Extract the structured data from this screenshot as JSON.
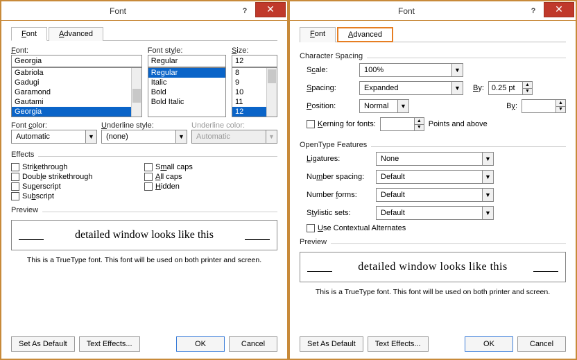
{
  "dialog1": {
    "title": "Font",
    "tabs": {
      "font": "Font",
      "advanced": "Advanced"
    },
    "font_label": "Font:",
    "font_value": "Georgia",
    "font_list": [
      "Gabriola",
      "Gadugi",
      "Garamond",
      "Gautami",
      "Georgia"
    ],
    "style_label": "Font style:",
    "style_value": "Regular",
    "style_list": [
      "Regular",
      "Italic",
      "Bold",
      "Bold Italic"
    ],
    "size_label": "Size:",
    "size_value": "12",
    "size_list": [
      "8",
      "9",
      "10",
      "11",
      "12"
    ],
    "fontcolor_label": "Font color:",
    "fontcolor_value": "Automatic",
    "ustyle_label": "Underline style:",
    "ustyle_value": "(none)",
    "ucolor_label": "Underline color:",
    "ucolor_value": "Automatic",
    "effects_label": "Effects",
    "eff": {
      "strike": "Strikethrough",
      "dstrike": "Double strikethrough",
      "super": "Superscript",
      "sub": "Subscript",
      "small": "Small caps",
      "all": "All caps",
      "hidden": "Hidden"
    },
    "preview_label": "Preview",
    "preview_text": "detailed window looks like this",
    "note": "This is a TrueType font. This font will be used on both printer and screen.",
    "btn_default": "Set As Default",
    "btn_texteff": "Text Effects...",
    "btn_ok": "OK",
    "btn_cancel": "Cancel"
  },
  "dialog2": {
    "title": "Font",
    "tabs": {
      "font": "Font",
      "advanced": "Advanced"
    },
    "charspacing": "Character Spacing",
    "scale_label": "Scale:",
    "scale_value": "100%",
    "spacing_label": "Spacing:",
    "spacing_value": "Expanded",
    "by_label": "By:",
    "spacing_by": "0.25 pt",
    "position_label": "Position:",
    "position_value": "Normal",
    "position_by": "",
    "kerning_label": "Kerning for fonts:",
    "kerning_value": "",
    "kerning_suffix": "Points and above",
    "otf": "OpenType Features",
    "lig_label": "Ligatures:",
    "lig_value": "None",
    "nspace_label": "Number spacing:",
    "nspace_value": "Default",
    "nform_label": "Number forms:",
    "nform_value": "Default",
    "sset_label": "Stylistic sets:",
    "sset_value": "Default",
    "ctxalt": "Use Contextual Alternates",
    "preview_label": "Preview",
    "preview_text": "detailed window looks like this",
    "note": "This is a TrueType font. This font will be used on both printer and screen.",
    "btn_default": "Set As Default",
    "btn_texteff": "Text Effects...",
    "btn_ok": "OK",
    "btn_cancel": "Cancel"
  }
}
